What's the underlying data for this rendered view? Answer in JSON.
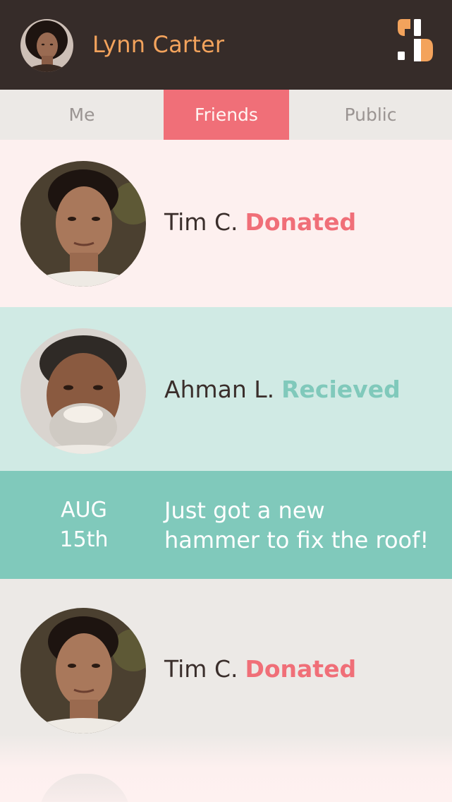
{
  "header": {
    "user_name": "Lynn Carter",
    "avatar_icon": "user-avatar-photo",
    "logo_icon": "app-logo",
    "accent_color": "#f3a35c"
  },
  "tabs": [
    {
      "label": "Me",
      "active": false
    },
    {
      "label": "Friends",
      "active": true
    },
    {
      "label": "Public",
      "active": false
    }
  ],
  "feed": [
    {
      "name": "Tim C.",
      "action": "Donated",
      "action_color": "#f06f78"
    },
    {
      "name": "Ahman L.",
      "action": "Recieved",
      "action_color": "#80c9bb"
    },
    {
      "date_month": "AUG",
      "date_day": "15th",
      "message_line1": "Just got a new",
      "message_line2": "hammer to fix the roof!"
    },
    {
      "name": "Tim C.",
      "action": "Donated",
      "action_color": "#f06f78"
    }
  ]
}
